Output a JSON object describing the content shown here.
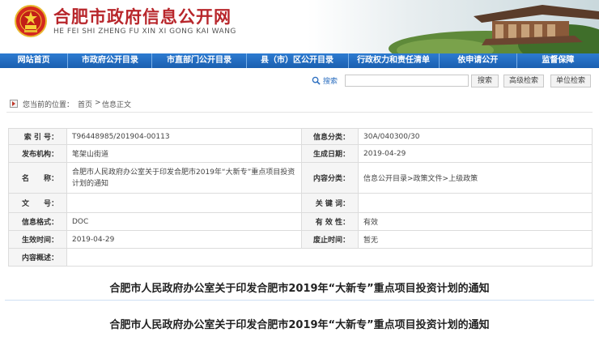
{
  "header": {
    "title": "合肥市政府信息公开网",
    "pinyin": "HE FEI SHI ZHENG FU XIN XI GONG KAI WANG"
  },
  "nav": [
    {
      "label": "网站首页"
    },
    {
      "label": "市政府公开目录"
    },
    {
      "label": "市直部门公开目录"
    },
    {
      "label": "县（市）区公开目录"
    },
    {
      "label": "行政权力和责任清单"
    },
    {
      "label": "依申请公开"
    },
    {
      "label": "监督保障"
    }
  ],
  "search": {
    "label": "搜索",
    "value": "",
    "buttons": {
      "search": "搜索",
      "advanced": "高级检索",
      "unit": "单位检索"
    }
  },
  "breadcrumb": {
    "prefix": "您当前的位置：",
    "home": "首页",
    "sep": ">",
    "current": "信息正文"
  },
  "meta": {
    "index_label": "索 引 号：",
    "index_value": "T96448985/201904-00113",
    "category_label": "信息分类：",
    "category_value": "30A/040300/30",
    "publisher_label": "发布机构：",
    "publisher_value": "笔架山街道",
    "created_label": "生成日期：",
    "created_value": "2019-04-29",
    "name_label": "名　　称：",
    "name_value": "合肥市人民政府办公室关于印发合肥市2019年“大新专”重点项目投资计划的通知",
    "content_label": "内容分类：",
    "content_value": "信息公开目录>政策文件>上级政策",
    "docno_label": "文　　号：",
    "docno_value": "",
    "keywords_label": "关 键 词：",
    "keywords_value": "",
    "format_label": "信息格式：",
    "format_value": "DOC",
    "validity_label": "有 效 性：",
    "validity_value": "有效",
    "effective_label": "生效时间：",
    "effective_value": "2019-04-29",
    "abolish_label": "废止时间：",
    "abolish_value": "暂无",
    "summary_label": "内容概述：",
    "summary_value": ""
  },
  "doc_title": "合肥市人民政府办公室关于印发合肥市2019年“大新专”重点项目投资计划的通知",
  "colors": {
    "brand_red": "#b8262b",
    "nav_blue": "#1a5fb0"
  }
}
